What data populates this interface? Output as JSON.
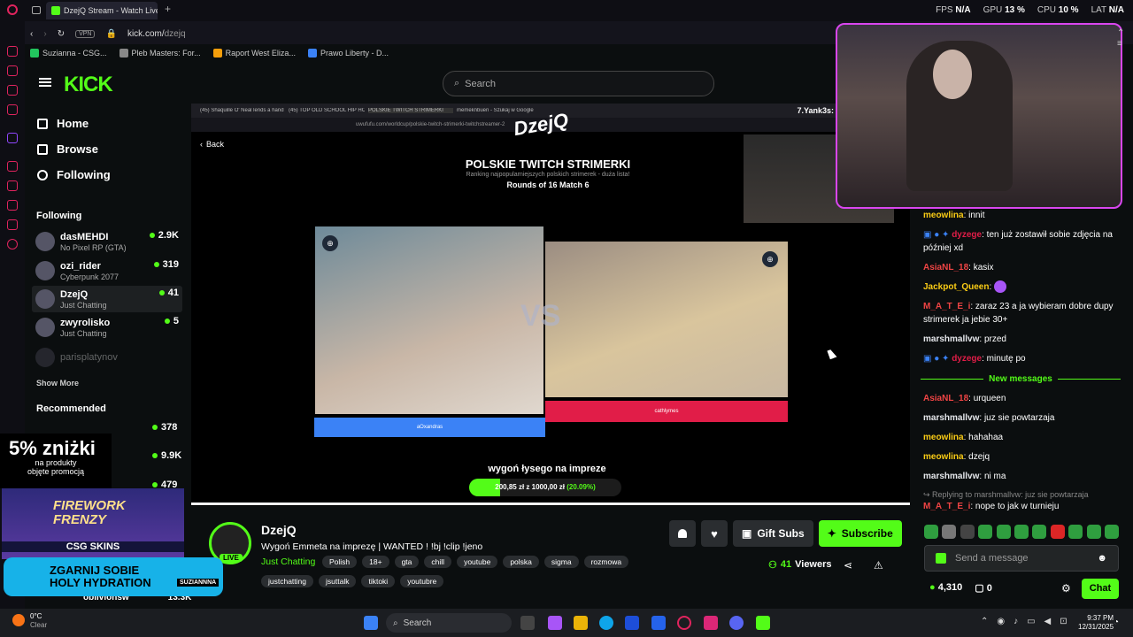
{
  "browser": {
    "tab_title": "DzejQ Stream - Watch Live",
    "url_prefix": "kick.com/",
    "url_path": "dzejq",
    "vpn": "VPN",
    "stats": [
      {
        "label": "FPS",
        "value": "N/A"
      },
      {
        "label": "GPU",
        "value": "13 %"
      },
      {
        "label": "CPU",
        "value": "10 %"
      },
      {
        "label": "LAT",
        "value": "N/A"
      }
    ],
    "bookmarks": [
      {
        "label": "Suzianna - CSG...",
        "color": "#22c55e"
      },
      {
        "label": "Pleb Masters: For...",
        "color": "#888"
      },
      {
        "label": "Raport West Eliza...",
        "color": "#f59e0b"
      },
      {
        "label": "Prawo Liberty - D...",
        "color": "#3b82f6"
      }
    ]
  },
  "kick": {
    "search_placeholder": "Search",
    "nav": [
      {
        "label": "Home"
      },
      {
        "label": "Browse"
      },
      {
        "label": "Following"
      }
    ],
    "following_header": "Following",
    "recommended_header": "Recommended",
    "show_more": "Show More",
    "following": [
      {
        "name": "dasMEHDI",
        "cat": "No Pixel RP (GTA)",
        "count": "2.9K"
      },
      {
        "name": "ozi_rider",
        "cat": "Cyberpunk 2077",
        "count": "319"
      },
      {
        "name": "DzejQ",
        "cat": "Just Chatting",
        "count": "41"
      },
      {
        "name": "zwyrolisko",
        "cat": "Just Chatting",
        "count": "5"
      },
      {
        "name": "parisplatynov",
        "cat": "",
        "count": ""
      }
    ],
    "recommended_counts": [
      "378",
      "9.9K",
      "479",
      "13.3K"
    ],
    "recommended_partial": "oblivionsw"
  },
  "player": {
    "inner_tabs": [
      "(45) Shaquille O' Neal lends a hand i...",
      "(45) TOP OLD SCHOOL HIP HOP",
      "POLSKIE TWITCH STRIMERKI",
      "memeknbuen - Szukaj w Google"
    ],
    "inner_url": "uwufufu.com/worldcup/polskie-twitch-strimerki-twitchstreamer-2",
    "overlay_name": "7.Yank3s:",
    "back": "Back",
    "title": "POLSKIE TWITCH STRIMERKI",
    "subtitle": "Ranking najpopularniejszych polskich strimerek - duża lista!",
    "round": "Rounds of 16 Match 6",
    "vs": "VS",
    "choice1": "aOxandras",
    "choice2": "cathlymes",
    "goal_text": "wygoń łysego na impreze",
    "goal_current": "200,85 zł",
    "goal_sep": "z",
    "goal_target": "1000,00 zł",
    "goal_pct": "(20.09%)",
    "goal_fraction": 0.2009
  },
  "stream": {
    "name": "DzejQ",
    "live": "LIVE",
    "title": "Wygoń Emmeta na imprezę | WANTED ! !bj !clip !jeno",
    "category": "Just Chatting",
    "tags1": [
      "Polish",
      "18+",
      "gta",
      "chill",
      "youtube",
      "polska",
      "sigma",
      "rozmowa"
    ],
    "tags2": [
      "justchatting",
      "jsuttalk",
      "tiktoki",
      "youtubre"
    ],
    "gift": "Gift Subs",
    "subscribe": "Subscribe",
    "viewers": "41",
    "viewers_label": "Viewers"
  },
  "chat": {
    "messages": [
      {
        "user": "meowlina",
        "color": "#facc15",
        "text": "innit"
      },
      {
        "user": "dyzege",
        "color": "#e11d48",
        "text": "ten już zostawił sobie zdjęcia na później xd"
      },
      {
        "user": "AsiaNL_18",
        "color": "#ef4444",
        "text": "kasix"
      },
      {
        "user": "Jackpot_Queen",
        "color": "#facc15",
        "text": ""
      },
      {
        "user": "M_A_T_E_i",
        "color": "#ef4444",
        "text": "zaraz 23 a ja wybieram dobre dupy strimerek ja jebie 30+"
      },
      {
        "user": "marshmallvw",
        "color": "#e5e7eb",
        "text": "przed"
      },
      {
        "user": "dyzege",
        "color": "#e11d48",
        "text": "minutę po"
      },
      {
        "user": "AsiaNL_18",
        "color": "#ef4444",
        "text": "urqueen"
      },
      {
        "user": "marshmallvw",
        "color": "#e5e7eb",
        "text": "juz sie powtarzaja"
      },
      {
        "user": "meowlina",
        "color": "#facc15",
        "text": "hahahaa"
      },
      {
        "user": "meowlina",
        "color": "#facc15",
        "text": "dzejq"
      },
      {
        "user": "marshmallvw",
        "color": "#e5e7eb",
        "text": "ni ma"
      },
      {
        "user": "M_A_T_E_i",
        "color": "#ef4444",
        "text": "nope to jak w turnieju"
      }
    ],
    "new_messages": "New messages",
    "reply": "Replying to marshmallvw: juz sie powtarzaja",
    "input_placeholder": "Send a message",
    "points": "4,310",
    "count": "0",
    "send": "Chat"
  },
  "ads": {
    "discount": "5% zniżki",
    "discount_sub1": "na produkty",
    "discount_sub2": "objęte promocją",
    "game_title1": "FIREWORK",
    "game_title2": "FRENZY",
    "game_brand": "CSG SKINS",
    "hydration1": "ZGARNIJ SOBIE",
    "hydration2": "HOLY HYDRATION",
    "hydration_tag": "SUZIANNNA"
  },
  "taskbar": {
    "temp": "0°C",
    "weather": "Clear",
    "search": "Search",
    "time": "9:37 PM",
    "date": "12/31/2025"
  }
}
